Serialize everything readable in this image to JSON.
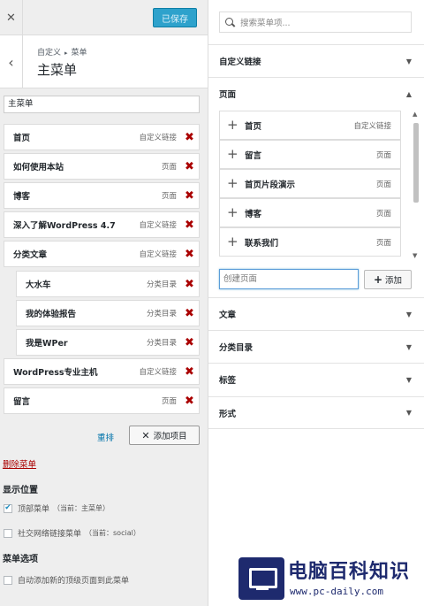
{
  "header": {
    "close_icon": "close-icon",
    "save_label": "已保存"
  },
  "breadcrumb": {
    "parent": "自定义",
    "child": "菜单"
  },
  "page_title": "主菜单",
  "menu_name_value": "主菜单",
  "menu_items": [
    {
      "title": "首页",
      "type": "自定义链接"
    },
    {
      "title": "如何使用本站",
      "type": "页面"
    },
    {
      "title": "博客",
      "type": "页面"
    },
    {
      "title": "深入了解WordPress 4.7",
      "type": "自定义链接"
    },
    {
      "title": "分类文章",
      "type": "自定义链接"
    },
    {
      "title": "大水车",
      "type": "分类目录"
    },
    {
      "title": "我的体验报告",
      "type": "分类目录"
    },
    {
      "title": "我是WPer",
      "type": "分类目录"
    },
    {
      "title": "WordPress专业主机",
      "type": "自定义链接"
    },
    {
      "title": "留言",
      "type": "页面"
    }
  ],
  "actions": {
    "reorder": "重排",
    "add_items": "添加项目",
    "delete_menu": "删除菜单"
  },
  "locations": {
    "heading": "显示位置",
    "options": [
      {
        "label": "顶部菜单",
        "hint": "（当前：主菜单）",
        "checked": true
      },
      {
        "label": "社交网络链接菜单",
        "hint": "（当前：social）",
        "checked": false
      }
    ]
  },
  "menu_options": {
    "heading": "菜单选项",
    "auto_add": {
      "label": "自动添加新的顶级页面到此菜单",
      "checked": false
    }
  },
  "search": {
    "placeholder": "搜索菜单项..."
  },
  "sections": {
    "custom_links": "自定义链接",
    "pages": "页面",
    "posts": "文章",
    "categories": "分类目录",
    "tags": "标签",
    "formats": "形式"
  },
  "pages_list": [
    {
      "title": "首页",
      "type": "自定义链接"
    },
    {
      "title": "留言",
      "type": "页面"
    },
    {
      "title": "首页片段演示",
      "type": "页面"
    },
    {
      "title": "博客",
      "type": "页面"
    },
    {
      "title": "联系我们",
      "type": "页面"
    }
  ],
  "new_page": {
    "placeholder": "创建页面",
    "add_label": "添加"
  },
  "watermark": {
    "text": "电脑百科知识",
    "url": "www.pc-daily.com"
  },
  "colors": {
    "accent": "#2ea2cc",
    "remove": "#aa0000",
    "link": "#0073aa"
  }
}
